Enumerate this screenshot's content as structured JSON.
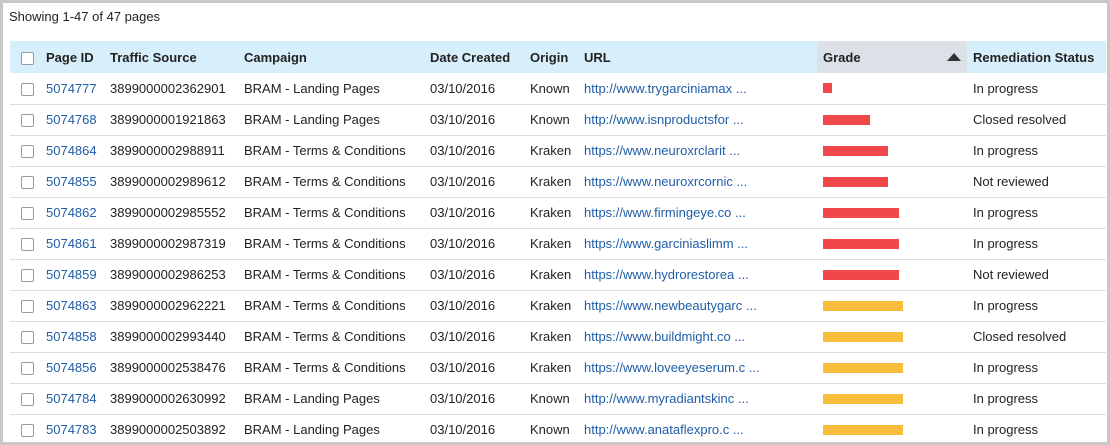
{
  "summary": "Showing 1-47 of 47 pages",
  "colors": {
    "red": "#f0474a",
    "yellow": "#f7bd3b",
    "link": "#1f5da8"
  },
  "columns": {
    "page_id": "Page ID",
    "traffic_source": "Traffic Source",
    "campaign": "Campaign",
    "date_created": "Date Created",
    "origin": "Origin",
    "url": "URL",
    "grade": "Grade",
    "remediation_status": "Remediation Status"
  },
  "sort": {
    "column": "Grade",
    "direction": "ascending",
    "icon": "sort-up-icon"
  },
  "rows": [
    {
      "page_id": "5074777",
      "traffic_source": "3899000002362901",
      "campaign": "BRAM - Landing Pages",
      "date_created": "03/10/2016",
      "origin": "Known",
      "url": "http://www.trygarciniamax ...",
      "grade_level": 0.11,
      "grade_color": "red",
      "status": "In progress"
    },
    {
      "page_id": "5074768",
      "traffic_source": "3899000001921863",
      "campaign": "BRAM - Landing Pages",
      "date_created": "03/10/2016",
      "origin": "Known",
      "url": "http://www.isnproductsfor ...",
      "grade_level": 0.59,
      "grade_color": "red",
      "status": "Closed resolved"
    },
    {
      "page_id": "5074864",
      "traffic_source": "3899000002988911",
      "campaign": "BRAM - Terms & Conditions",
      "date_created": "03/10/2016",
      "origin": "Kraken",
      "url": "https://www.neuroxrclarit ...",
      "grade_level": 0.81,
      "grade_color": "red",
      "status": "In progress"
    },
    {
      "page_id": "5074855",
      "traffic_source": "3899000002989612",
      "campaign": "BRAM - Terms & Conditions",
      "date_created": "03/10/2016",
      "origin": "Kraken",
      "url": "https://www.neuroxrcornic ...",
      "grade_level": 0.81,
      "grade_color": "red",
      "status": "Not reviewed"
    },
    {
      "page_id": "5074862",
      "traffic_source": "3899000002985552",
      "campaign": "BRAM - Terms & Conditions",
      "date_created": "03/10/2016",
      "origin": "Kraken",
      "url": "https://www.firmingeye.co ...",
      "grade_level": 0.95,
      "grade_color": "red",
      "status": "In progress"
    },
    {
      "page_id": "5074861",
      "traffic_source": "3899000002987319",
      "campaign": "BRAM - Terms & Conditions",
      "date_created": "03/10/2016",
      "origin": "Kraken",
      "url": "https://www.garciniaslimm ...",
      "grade_level": 0.95,
      "grade_color": "red",
      "status": "In progress"
    },
    {
      "page_id": "5074859",
      "traffic_source": "3899000002986253",
      "campaign": "BRAM - Terms & Conditions",
      "date_created": "03/10/2016",
      "origin": "Kraken",
      "url": "https://www.hydrorestorea ...",
      "grade_level": 0.95,
      "grade_color": "red",
      "status": "Not reviewed"
    },
    {
      "page_id": "5074863",
      "traffic_source": "3899000002962221",
      "campaign": "BRAM - Terms & Conditions",
      "date_created": "03/10/2016",
      "origin": "Kraken",
      "url": "https://www.newbeautygarc ...",
      "grade_level": 1.0,
      "grade_color": "yellow",
      "status": "In progress"
    },
    {
      "page_id": "5074858",
      "traffic_source": "3899000002993440",
      "campaign": "BRAM - Terms & Conditions",
      "date_created": "03/10/2016",
      "origin": "Kraken",
      "url": "https://www.buildmight.co ...",
      "grade_level": 1.0,
      "grade_color": "yellow",
      "status": "Closed resolved"
    },
    {
      "page_id": "5074856",
      "traffic_source": "3899000002538476",
      "campaign": "BRAM - Terms & Conditions",
      "date_created": "03/10/2016",
      "origin": "Kraken",
      "url": "https://www.loveeyeserum.c ...",
      "grade_level": 1.0,
      "grade_color": "yellow",
      "status": "In progress"
    },
    {
      "page_id": "5074784",
      "traffic_source": "3899000002630992",
      "campaign": "BRAM - Landing Pages",
      "date_created": "03/10/2016",
      "origin": "Known",
      "url": "http://www.myradiantskinc ...",
      "grade_level": 1.0,
      "grade_color": "yellow",
      "status": "In progress"
    },
    {
      "page_id": "5074783",
      "traffic_source": "3899000002503892",
      "campaign": "BRAM - Landing Pages",
      "date_created": "03/10/2016",
      "origin": "Known",
      "url": "http://www.anataflexpro.c ...",
      "grade_level": 1.0,
      "grade_color": "yellow",
      "status": "In progress"
    }
  ]
}
